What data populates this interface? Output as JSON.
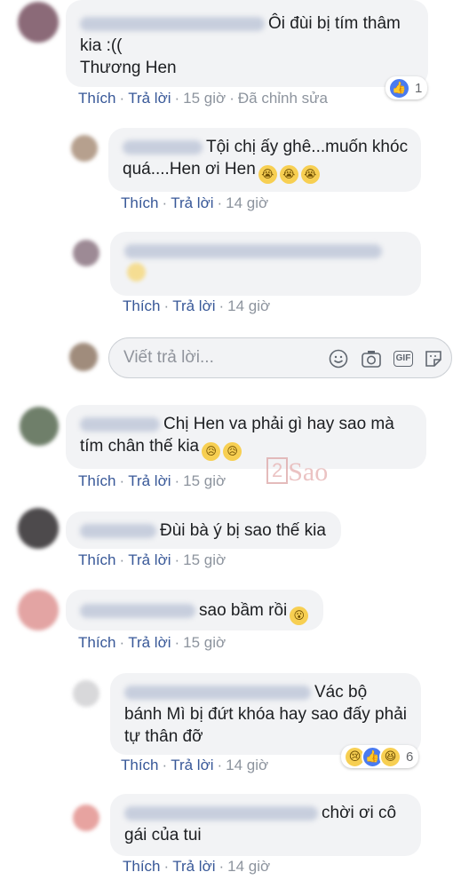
{
  "actions": {
    "like": "Thích",
    "reply": "Trả lời",
    "sep": "·"
  },
  "reply_input": {
    "placeholder": "Viết trả lời..."
  },
  "reply_tools": [
    "emoji-icon",
    "camera-icon",
    "gif-icon",
    "sticker-icon"
  ],
  "gif_label": "GIF",
  "watermark": {
    "num": "2",
    "text": "Sao"
  },
  "comments": [
    {
      "text": "Ôi đùi bị tím thâm kia :((\nThương Hen",
      "time": "15 giờ",
      "edited": "Đã chỉnh sửa",
      "reaction_count": "1"
    },
    {
      "text": "Tội chị ấy ghê...muốn khóc quá....Hen ơi Hen",
      "time": "14 giờ"
    },
    {
      "text": "",
      "time": "14 giờ"
    },
    {
      "text": "Chị Hen va phải gì hay sao mà tím chân thế kia",
      "time": "15 giờ"
    },
    {
      "text": "Đùi bà ý bị sao thế kia",
      "time": "15 giờ"
    },
    {
      "text": "sao bầm rồi",
      "time": "15 giờ"
    },
    {
      "text": "Vác bộ bánh Mì bị đứt khóa hay sao đấy phải tự thân đỡ",
      "time": "14 giờ",
      "reaction_count": "6"
    },
    {
      "text": "chời ơi cô gái của tui",
      "time": "14 giờ"
    }
  ],
  "colors": {
    "link": "#385898",
    "bubble": "#f2f3f5",
    "meta": "#8d949e",
    "like_blue": "#4a7bf0"
  }
}
